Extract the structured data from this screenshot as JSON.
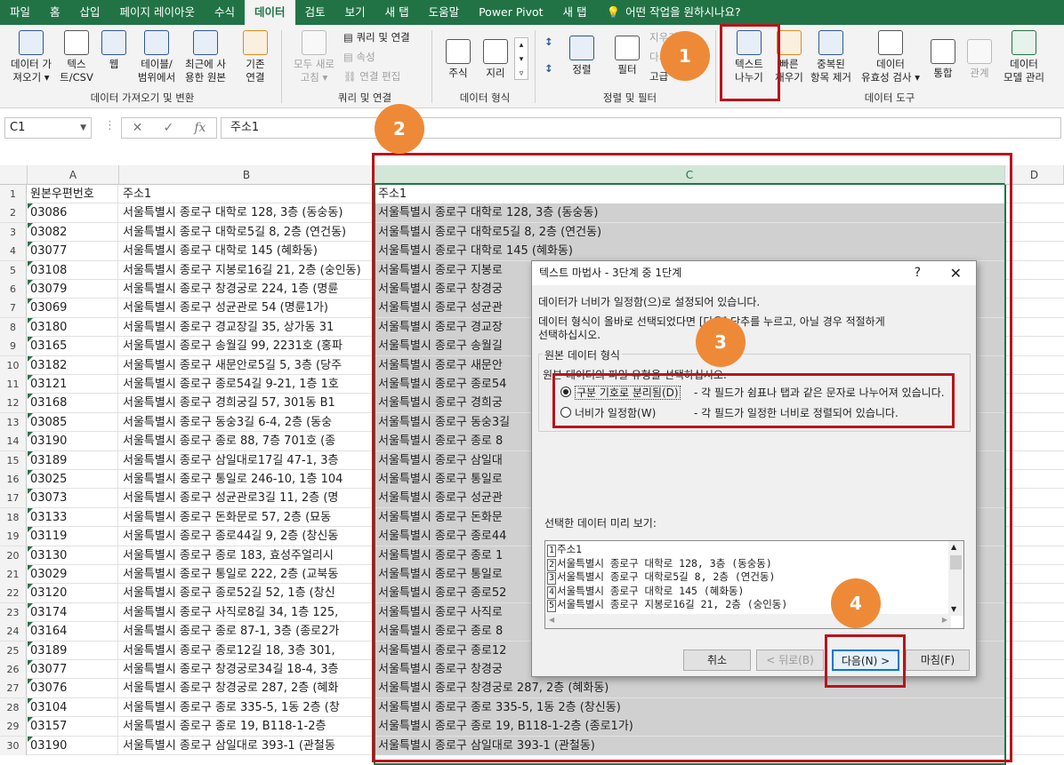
{
  "tabs": [
    "파일",
    "홈",
    "삽입",
    "페이지 레이아웃",
    "수식",
    "데이터",
    "검토",
    "보기",
    "새 탭",
    "도움말",
    "Power Pivot",
    "새 탭"
  ],
  "active_tab": "데이터",
  "tell_me": "어떤 작업을 원하시나요?",
  "ribbon": {
    "get_data": {
      "label1": "데이터 가",
      "label2": "져오기 ▾"
    },
    "text_csv": {
      "label1": "텍스",
      "label2": "트/CSV"
    },
    "web": {
      "label1": "웹"
    },
    "table_range": {
      "label1": "테이블/",
      "label2": "범위에서"
    },
    "recent": {
      "label1": "최근에 사",
      "label2": "용한 원본"
    },
    "existing": {
      "label1": "기존",
      "label2": "연결"
    },
    "group1": "데이터 가져오기 및 변환",
    "refresh_all": {
      "label1": "모두 새로",
      "label2": "고침 ▾"
    },
    "queries_conn": "쿼리 및 연결",
    "properties": "속성",
    "edit_links": "연결 편집",
    "group2": "쿼리 및 연결",
    "stocks": "주식",
    "geography": "지리",
    "group3": "데이터 형식",
    "sort": "정렬",
    "filter": "필터",
    "clear": "지우기",
    "reapply": "다시 적용",
    "advanced": "고급",
    "group4": "정렬 및 필터",
    "text_to_columns": {
      "label1": "텍스트",
      "label2": "나누기"
    },
    "flash_fill": {
      "label1": "빠른",
      "label2": "채우기"
    },
    "remove_dup": {
      "label1": "중복된",
      "label2": "항목 제거"
    },
    "validation": {
      "label1": "데이터",
      "label2": "유효성 검사 ▾"
    },
    "consolidate": "통합",
    "relationships": "관계",
    "data_model": {
      "label1": "데이터",
      "label2": "모델 관리"
    },
    "group5": "데이터 도구"
  },
  "name_box": "C1",
  "formula": "주소1",
  "columns": [
    "A",
    "B",
    "C",
    "D"
  ],
  "rows": [
    {
      "n": "1",
      "a": "원본우편번호",
      "b": "주소1",
      "c": "주소1"
    },
    {
      "n": "2",
      "a": "03086",
      "b": "서울특별시 종로구 대학로 128, 3층 (동숭동)",
      "c": "서울특별시 종로구 대학로 128, 3층 (동숭동)"
    },
    {
      "n": "3",
      "a": "03082",
      "b": "서울특별시 종로구 대학로5길 8, 2층 (연건동)",
      "c": "서울특별시 종로구 대학로5길 8, 2층 (연건동)"
    },
    {
      "n": "4",
      "a": "03077",
      "b": "서울특별시 종로구 대학로 145 (혜화동)",
      "c": "서울특별시 종로구 대학로 145 (혜화동)"
    },
    {
      "n": "5",
      "a": "03108",
      "b": "서울특별시 종로구 지봉로16길 21, 2층 (숭인동)",
      "c": "서울특별시 종로구 지봉로"
    },
    {
      "n": "6",
      "a": "03079",
      "b": "서울특별시 종로구 창경궁로 224, 1층 (명륜",
      "c": "서울특별시 종로구 창경궁"
    },
    {
      "n": "7",
      "a": "03069",
      "b": "서울특별시 종로구 성균관로 54 (명륜1가)",
      "c": "서울특별시 종로구 성균관"
    },
    {
      "n": "8",
      "a": "03180",
      "b": "서울특별시 종로구 경교장길 35, 상가동 31",
      "c": "서울특별시 종로구 경교장"
    },
    {
      "n": "9",
      "a": "03165",
      "b": "서울특별시 종로구 송월길 99, 2231호 (홍파",
      "c": "서울특별시 종로구 송월길"
    },
    {
      "n": "10",
      "a": "03182",
      "b": "서울특별시 종로구 새문안로5길 5, 3층 (당주",
      "c": "서울특별시 종로구 새문안"
    },
    {
      "n": "11",
      "a": "03121",
      "b": "서울특별시 종로구 종로54길 9-21, 1층 1호",
      "c": "서울특별시 종로구 종로54"
    },
    {
      "n": "12",
      "a": "03168",
      "b": "서울특별시 종로구 경희궁길 57, 301동 B1",
      "c": "서울특별시 종로구 경희궁"
    },
    {
      "n": "13",
      "a": "03085",
      "b": "서울특별시 종로구 동숭3길 6-4, 2층 (동숭",
      "c": "서울특별시 종로구 동숭3길"
    },
    {
      "n": "14",
      "a": "03190",
      "b": "서울특별시 종로구 종로 88, 7층 701호 (종",
      "c": "서울특별시 종로구 종로 8"
    },
    {
      "n": "15",
      "a": "03189",
      "b": "서울특별시 종로구 삼일대로17길 47-1, 3층",
      "c": "서울특별시 종로구 삼일대"
    },
    {
      "n": "16",
      "a": "03025",
      "b": "서울특별시 종로구 통일로 246-10, 1층 104",
      "c": "서울특별시 종로구 통일로"
    },
    {
      "n": "17",
      "a": "03073",
      "b": "서울특별시 종로구 성균관로3길 11, 2층 (명",
      "c": "서울특별시 종로구 성균관"
    },
    {
      "n": "18",
      "a": "03133",
      "b": "서울특별시 종로구 돈화문로 57, 2층 (묘동",
      "c": "서울특별시 종로구 돈화문"
    },
    {
      "n": "19",
      "a": "03119",
      "b": "서울특별시 종로구 종로44길 9, 2층 (창신동",
      "c": "서울특별시 종로구 종로44"
    },
    {
      "n": "20",
      "a": "03130",
      "b": "서울특별시 종로구 종로 183, 효성주얼리시",
      "c": "서울특별시 종로구 종로 1"
    },
    {
      "n": "21",
      "a": "03029",
      "b": "서울특별시 종로구 통일로 222, 2층 (교북동",
      "c": "서울특별시 종로구 통일로"
    },
    {
      "n": "22",
      "a": "03120",
      "b": "서울특별시 종로구 종로52길 52, 1층 (창신",
      "c": "서울특별시 종로구 종로52"
    },
    {
      "n": "23",
      "a": "03174",
      "b": "서울특별시 종로구 사직로8길 34, 1층 125,",
      "c": "서울특별시 종로구 사직로"
    },
    {
      "n": "24",
      "a": "03164",
      "b": "서울특별시 종로구 종로 87-1, 3층 (종로2가",
      "c": "서울특별시 종로구 종로 8"
    },
    {
      "n": "25",
      "a": "03189",
      "b": "서울특별시 종로구 종로12길 18, 3층 301,",
      "c": "서울특별시 종로구 종로12"
    },
    {
      "n": "26",
      "a": "03077",
      "b": "서울특별시 종로구 창경궁로34길 18-4, 3층",
      "c": "서울특별시 종로구 창경궁"
    },
    {
      "n": "27",
      "a": "03076",
      "b": "서울특별시 종로구 창경궁로 287, 2층 (혜화",
      "c": "서울특별시 종로구 창경궁로 287, 2층 (혜화동)"
    },
    {
      "n": "28",
      "a": "03104",
      "b": "서울특별시 종로구 종로 335-5, 1동 2층 (창",
      "c": "서울특별시 종로구 종로 335-5, 1동 2층 (창신동)"
    },
    {
      "n": "29",
      "a": "03157",
      "b": "서울특별시 종로구 종로 19, B118-1-2층",
      "c": "서울특별시 종로구 종로 19, B118-1-2층 (종로1가)"
    },
    {
      "n": "30",
      "a": "03190",
      "b": "서울특별시 종로구 삼일대로 393-1 (관철동",
      "c": "서울특별시 종로구 삼일대로 393-1 (관철동)"
    }
  ],
  "dialog": {
    "title": "텍스트 마법사 - 3단계 중 1단계",
    "help": "?",
    "close": "✕",
    "line1": "데이터가 너비가 일정함(으)로 설정되어 있습니다.",
    "line2": "데이터 형식이 올바로 선택되었다면 [다음] 단추를 누르고, 아닐 경우 적절하게",
    "line3": "선택하십시오.",
    "section": "원본 데이터 형식",
    "section_sub": "원본 데이터의 파일 유형을 선택하십시오.",
    "opt1": "구분 기호로 분리됨(D)",
    "opt1_desc": "- 각 필드가 쉼표나 탭과 같은 문자로 나누어져 있습니다.",
    "opt2": "너비가 일정함(W)",
    "opt2_desc": "- 각 필드가 일정한 너비로 정렬되어 있습니다.",
    "preview_label": "선택한 데이터 미리 보기:",
    "preview": [
      {
        "n": "1",
        "t": "주소1"
      },
      {
        "n": "2",
        "t": "서울특별시 종로구 대학로 128, 3층 (동숭동)"
      },
      {
        "n": "3",
        "t": "서울특별시 종로구 대학로5길 8, 2층 (연건동)"
      },
      {
        "n": "4",
        "t": "서울특별시 종로구 대학로 145 (혜화동)"
      },
      {
        "n": "5",
        "t": "서울특별시 종로구 지봉로16길 21, 2층 (숭인동)"
      }
    ],
    "cancel": "취소",
    "back": "< 뒤로(B)",
    "next": "다음(N) >",
    "finish": "마침(F)"
  },
  "badges": [
    "1",
    "2",
    "3",
    "4"
  ]
}
